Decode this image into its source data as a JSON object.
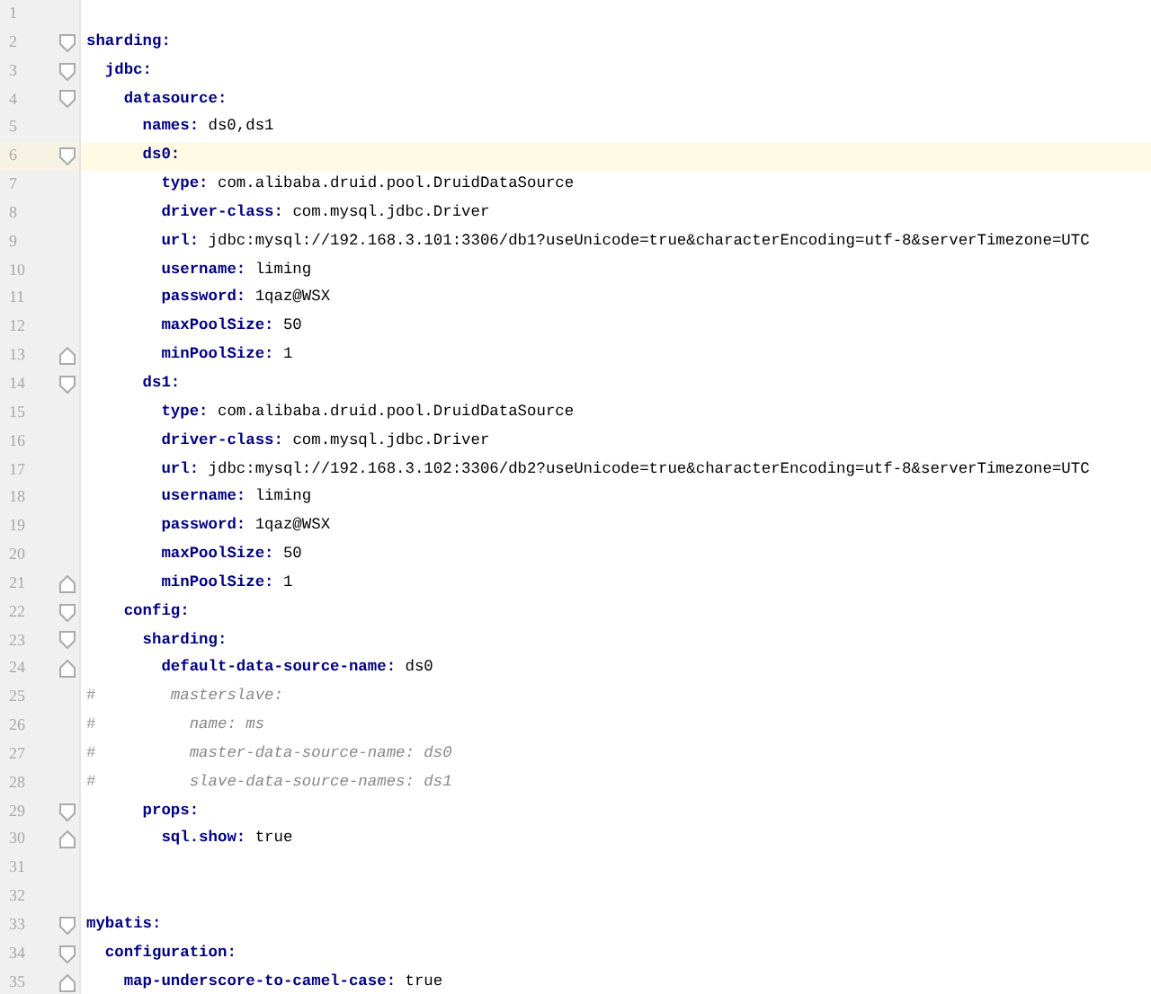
{
  "editor": {
    "lines": [
      {
        "number": "1",
        "kind": "blank",
        "highlighted": false,
        "fold_start": false,
        "fold_end": false
      },
      {
        "number": "2",
        "kind": "pair",
        "highlighted": false,
        "fold_start": true,
        "fold_end": false,
        "key": "sharding:",
        "children": [
          {
            "number": "3",
            "kind": "pair",
            "highlighted": false,
            "fold_start": true,
            "fold_end": false,
            "key": "jdbc:",
            "children": [
              {
                "number": "4",
                "kind": "pair",
                "highlighted": false,
                "fold_start": true,
                "fold_end": false,
                "key": "datasource:",
                "children": [
                  {
                    "number": "5",
                    "kind": "pair",
                    "highlighted": false,
                    "fold_start": false,
                    "fold_end": false,
                    "key": "names:",
                    "value": "ds0,ds1"
                  },
                  {
                    "number": "6",
                    "kind": "pair",
                    "highlighted": true,
                    "fold_start": true,
                    "fold_end": false,
                    "key": "ds0:",
                    "children": [
                      {
                        "number": "7",
                        "kind": "pair",
                        "highlighted": false,
                        "fold_start": false,
                        "fold_end": false,
                        "key": "type:",
                        "value": "com.alibaba.druid.pool.DruidDataSource"
                      },
                      {
                        "number": "8",
                        "kind": "pair",
                        "highlighted": false,
                        "fold_start": false,
                        "fold_end": false,
                        "key": "driver-class:",
                        "value": "com.mysql.jdbc.Driver"
                      },
                      {
                        "number": "9",
                        "kind": "pair",
                        "highlighted": false,
                        "fold_start": false,
                        "fold_end": false,
                        "key": "url:",
                        "value": "jdbc:mysql://192.168.3.101:3306/db1?useUnicode=true&characterEncoding=utf-8&serverTimezone=UTC"
                      },
                      {
                        "number": "10",
                        "kind": "pair",
                        "highlighted": false,
                        "fold_start": false,
                        "fold_end": false,
                        "key": "username:",
                        "value": "liming"
                      },
                      {
                        "number": "11",
                        "kind": "pair",
                        "highlighted": false,
                        "fold_start": false,
                        "fold_end": false,
                        "key": "password:",
                        "value": "1qaz@WSX"
                      },
                      {
                        "number": "12",
                        "kind": "pair",
                        "highlighted": false,
                        "fold_start": false,
                        "fold_end": false,
                        "key": "maxPoolSize:",
                        "value": "50"
                      },
                      {
                        "number": "13",
                        "kind": "pair",
                        "highlighted": false,
                        "fold_start": false,
                        "fold_end": true,
                        "key": "minPoolSize:",
                        "value": "1"
                      }
                    ]
                  },
                  {
                    "number": "14",
                    "kind": "pair",
                    "highlighted": false,
                    "fold_start": true,
                    "fold_end": false,
                    "key": "ds1:",
                    "children": [
                      {
                        "number": "15",
                        "kind": "pair",
                        "highlighted": false,
                        "fold_start": false,
                        "fold_end": false,
                        "key": "type:",
                        "value": "com.alibaba.druid.pool.DruidDataSource"
                      },
                      {
                        "number": "16",
                        "kind": "pair",
                        "highlighted": false,
                        "fold_start": false,
                        "fold_end": false,
                        "key": "driver-class:",
                        "value": "com.mysql.jdbc.Driver"
                      },
                      {
                        "number": "17",
                        "kind": "pair",
                        "highlighted": false,
                        "fold_start": false,
                        "fold_end": false,
                        "key": "url:",
                        "value": "jdbc:mysql://192.168.3.102:3306/db2?useUnicode=true&characterEncoding=utf-8&serverTimezone=UTC"
                      },
                      {
                        "number": "18",
                        "kind": "pair",
                        "highlighted": false,
                        "fold_start": false,
                        "fold_end": false,
                        "key": "username:",
                        "value": "liming"
                      },
                      {
                        "number": "19",
                        "kind": "pair",
                        "highlighted": false,
                        "fold_start": false,
                        "fold_end": false,
                        "key": "password:",
                        "value": "1qaz@WSX"
                      },
                      {
                        "number": "20",
                        "kind": "pair",
                        "highlighted": false,
                        "fold_start": false,
                        "fold_end": false,
                        "key": "maxPoolSize:",
                        "value": "50"
                      },
                      {
                        "number": "21",
                        "kind": "pair",
                        "highlighted": false,
                        "fold_start": false,
                        "fold_end": true,
                        "key": "minPoolSize:",
                        "value": "1"
                      }
                    ]
                  }
                ]
              },
              {
                "number": "22",
                "kind": "pair",
                "highlighted": false,
                "fold_start": true,
                "fold_end": false,
                "key": "config:",
                "children": [
                  {
                    "number": "23",
                    "kind": "pair",
                    "highlighted": false,
                    "fold_start": true,
                    "fold_end": false,
                    "key": "sharding:",
                    "children": [
                      {
                        "number": "24",
                        "kind": "pair",
                        "highlighted": false,
                        "fold_start": false,
                        "fold_end": true,
                        "key": "default-data-source-name:",
                        "value": "ds0"
                      }
                    ]
                  },
                  {
                    "number": "25",
                    "kind": "comment",
                    "highlighted": false,
                    "fold_start": false,
                    "fold_end": false,
                    "marker": "#",
                    "text": "masterslave:",
                    "children": [
                      {
                        "number": "26",
                        "kind": "comment",
                        "highlighted": false,
                        "fold_start": false,
                        "fold_end": false,
                        "marker": "#",
                        "text": "name: ms"
                      },
                      {
                        "number": "27",
                        "kind": "comment",
                        "highlighted": false,
                        "fold_start": false,
                        "fold_end": false,
                        "marker": "#",
                        "text": "master-data-source-name: ds0"
                      },
                      {
                        "number": "28",
                        "kind": "comment",
                        "highlighted": false,
                        "fold_start": false,
                        "fold_end": false,
                        "marker": "#",
                        "text": "slave-data-source-names: ds1"
                      }
                    ]
                  },
                  {
                    "number": "29",
                    "kind": "pair",
                    "highlighted": false,
                    "fold_start": true,
                    "fold_end": false,
                    "key": "props:",
                    "children": [
                      {
                        "number": "30",
                        "kind": "pair",
                        "highlighted": false,
                        "fold_start": false,
                        "fold_end": true,
                        "key": "sql.show:",
                        "value": "true"
                      }
                    ]
                  }
                ]
              }
            ]
          }
        ]
      },
      {
        "number": "31",
        "kind": "blank",
        "highlighted": false,
        "fold_start": false,
        "fold_end": false
      },
      {
        "number": "32",
        "kind": "blank",
        "highlighted": false,
        "fold_start": false,
        "fold_end": false
      },
      {
        "number": "33",
        "kind": "pair",
        "highlighted": false,
        "fold_start": true,
        "fold_end": false,
        "key": "mybatis:",
        "children": [
          {
            "number": "34",
            "kind": "pair",
            "highlighted": false,
            "fold_start": true,
            "fold_end": false,
            "key": "configuration:",
            "children": [
              {
                "number": "35",
                "kind": "pair",
                "highlighted": false,
                "fold_start": false,
                "fold_end": true,
                "key": "map-underscore-to-camel-case:",
                "value": "true"
              }
            ]
          }
        ]
      }
    ]
  }
}
